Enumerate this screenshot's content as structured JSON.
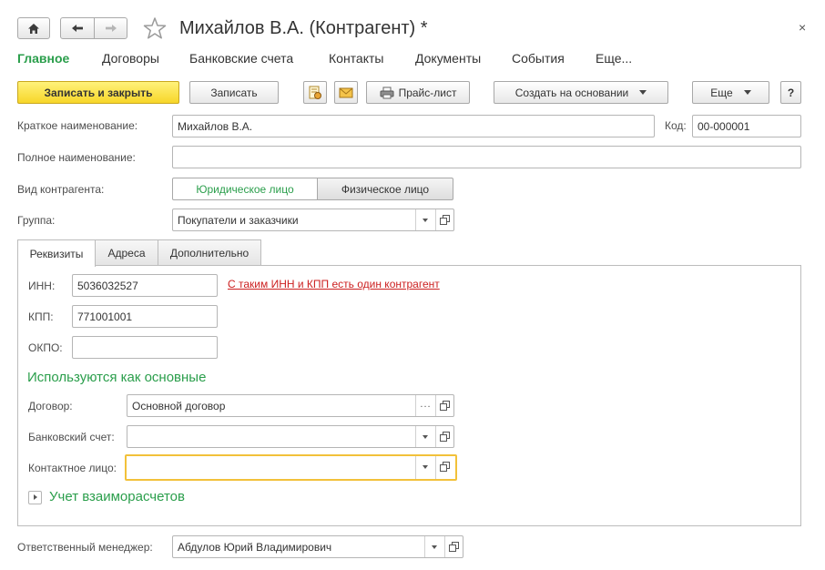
{
  "window": {
    "title": "Михайлов В.А. (Контрагент) *",
    "close_glyph": "×"
  },
  "nav": [
    {
      "label": "Главное",
      "active": true
    },
    {
      "label": "Договоры"
    },
    {
      "label": "Банковские счета"
    },
    {
      "label": "Контакты"
    },
    {
      "label": "Документы"
    },
    {
      "label": "События"
    },
    {
      "label": "Еще..."
    }
  ],
  "toolbar": {
    "save_close": "Записать и закрыть",
    "save": "Записать",
    "price_list": "Прайс-лист",
    "create_based": "Создать на основании",
    "more": "Еще",
    "help": "?"
  },
  "form": {
    "short_name_label": "Краткое наименование:",
    "short_name_value": "Михайлов В.А.",
    "code_label": "Код:",
    "code_value": "00-000001",
    "full_name_label": "Полное наименование:",
    "full_name_value": "",
    "kind_label": "Вид контрагента:",
    "kind_options": [
      "Юридическое лицо",
      "Физическое лицо"
    ],
    "kind_selected": "Физическое лицо",
    "group_label": "Группа:",
    "group_value": "Покупатели и заказчики"
  },
  "tabs": [
    {
      "label": "Реквизиты",
      "active": true
    },
    {
      "label": "Адреса"
    },
    {
      "label": "Дополнительно"
    }
  ],
  "requisites": {
    "inn_label": "ИНН:",
    "inn_value": "5036032527",
    "warning": "С таким ИНН и КПП есть один контрагент",
    "kpp_label": "КПП:",
    "kpp_value": "771001001",
    "okpo_label": "ОКПО:",
    "okpo_value": "",
    "main_group_title": "Используются как основные",
    "contract_label": "Договор:",
    "contract_value": "Основной договор",
    "bank_label": "Банковский счет:",
    "bank_value": "",
    "contact_label": "Контактное лицо:",
    "contact_value": "",
    "settlements_title": "Учет взаиморасчетов"
  },
  "footer": {
    "manager_label": "Ответственный менеджер:",
    "manager_value": "Абдулов Юрий Владимирович"
  },
  "icons": {
    "home": "home-icon",
    "back": "arrow-left-icon",
    "forward": "arrow-right-icon",
    "favorite": "star-icon",
    "report": "report-icon",
    "mail": "envelope-icon",
    "print": "printer-icon",
    "open": "open-form-icon"
  },
  "colors": {
    "accent_green": "#2a9e4b",
    "primary_yellow": "#f7d629",
    "warning_red": "#cc1f1f",
    "focus_orange": "#f2c13a"
  }
}
